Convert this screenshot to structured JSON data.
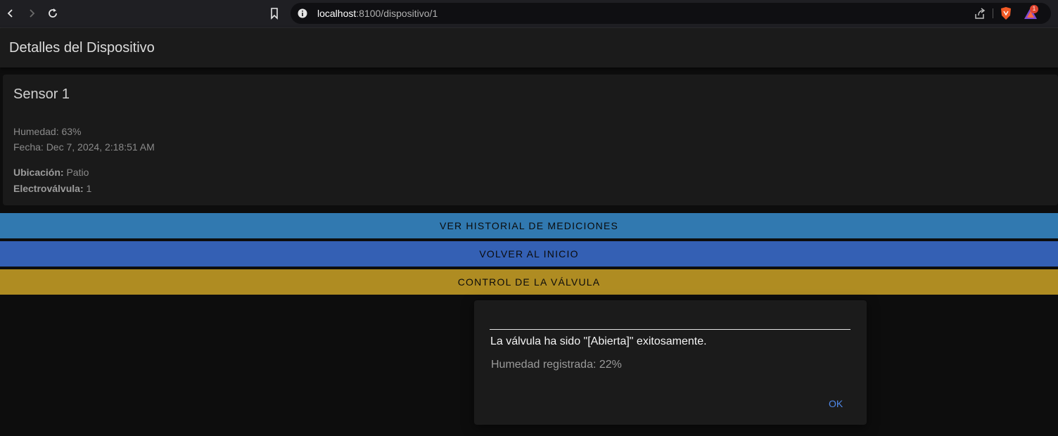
{
  "browser": {
    "url_host": "localhost",
    "url_path": ":8100/dispositivo/1",
    "rewards_count": "1"
  },
  "header": {
    "title": "Detalles del Dispositivo"
  },
  "device": {
    "name": "Sensor 1",
    "humidity_text": "Humedad: 63%",
    "date_text": "Fecha: Dec 7, 2024, 2:18:51 AM",
    "location_label": "Ubicación:",
    "location_value": " Patio",
    "valve_label": "Electroválvula:",
    "valve_value": " 1"
  },
  "actions": {
    "history_label": "VER HISTORIAL DE MEDICIONES",
    "home_label": "VOLVER AL INICIO",
    "valve_label": "CONTROL DE LA VÁLVULA"
  },
  "alert": {
    "message": "La válvula ha sido \"[Abierta]\" exitosamente.",
    "sub_message": "Humedad registrada: 22%",
    "ok_label": "OK"
  },
  "colors": {
    "history_button": "#3179b0",
    "home_button": "#3460b4",
    "valve_button": "#af8c22",
    "alert_ok": "#4f88e8"
  }
}
